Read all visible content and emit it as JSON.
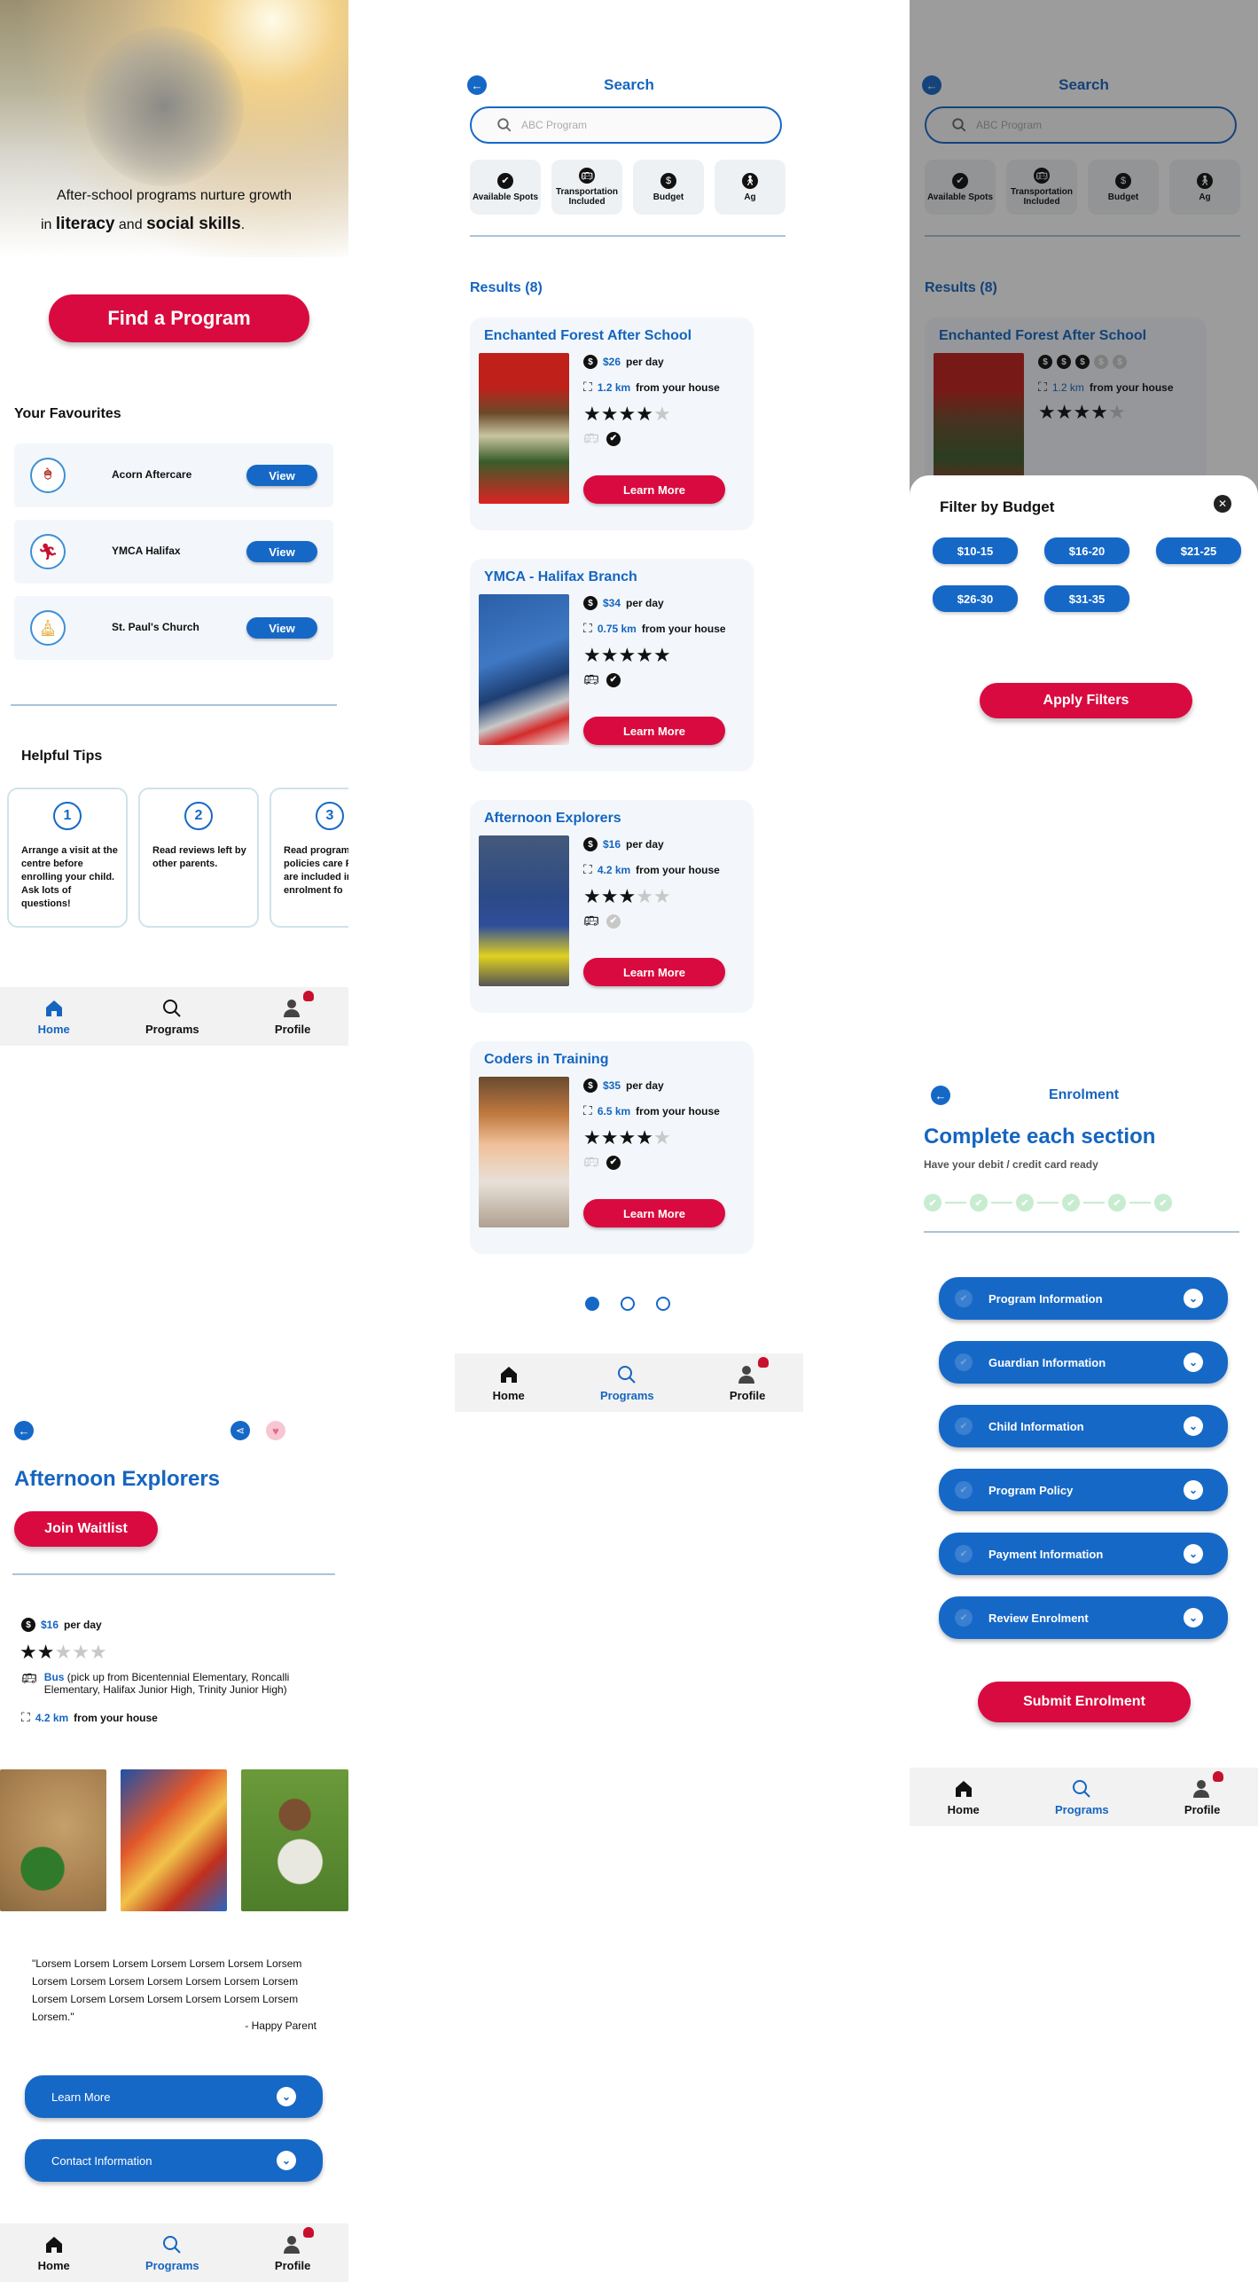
{
  "home": {
    "hero_line1": "After-school programs nurture growth",
    "hero_in": "in",
    "hero_literacy": "literacy",
    "hero_and": "and",
    "hero_social": "social skills",
    "hero_period": ".",
    "find_button": "Find a Program",
    "favourites_title": "Your Favourites",
    "favourites": [
      {
        "name": "Acorn Aftercare",
        "button": "View",
        "icon": "acorn-icon"
      },
      {
        "name": "YMCA Halifax",
        "button": "View",
        "icon": "runner-icon"
      },
      {
        "name": "St. Paul's Church",
        "button": "View",
        "icon": "church-icon"
      }
    ],
    "tips_title": "Helpful Tips",
    "tips": [
      {
        "num": "1",
        "text": "Arrange a visit at the centre before enrolling your child. Ask lots of questions!"
      },
      {
        "num": "2",
        "text": "Read reviews left by other parents."
      },
      {
        "num": "3",
        "text": "Read program policies care Policies are included in th enrolment fo"
      }
    ]
  },
  "nav": {
    "home": "Home",
    "programs": "Programs",
    "profile": "Profile"
  },
  "search": {
    "title": "Search",
    "placeholder": "ABC Program",
    "filters": [
      {
        "label": "Available Spots",
        "icon": "check-icon"
      },
      {
        "label": "Transportation Included",
        "icon": "bus-icon"
      },
      {
        "label": "Budget",
        "icon": "dollar-icon"
      },
      {
        "label": "Ag",
        "icon": "person-icon"
      }
    ],
    "results_label": "Results (8)",
    "per_day": "per day",
    "from_house": "from your house",
    "learn_more": "Learn More",
    "results": [
      {
        "name": "Enchanted Forest After School",
        "price": "$26",
        "distance": "1.2 km",
        "rating": 4,
        "transport": false,
        "spots": true
      },
      {
        "name": "YMCA - Halifax Branch",
        "price": "$34",
        "distance": "0.75 km",
        "rating": 5,
        "transport": true,
        "spots": true
      },
      {
        "name": "Afternoon Explorers",
        "price": "$16",
        "distance": "4.2 km",
        "rating": 3,
        "transport": true,
        "spots": false
      },
      {
        "name": "Coders in Training",
        "price": "$35",
        "distance": "6.5 km",
        "rating": 4,
        "transport": false,
        "spots": true
      }
    ],
    "pages": 3,
    "current_page": 1
  },
  "budget": {
    "overlay_title": "Search",
    "overlay_placeholder": "ABC Program",
    "overlay_result_name": "Enchanted Forest After School",
    "overlay_distance": "1.2 km",
    "overlay_from": "from your house",
    "overlay_results": "Results (8)",
    "sheet_title": "Filter by Budget",
    "options": [
      "$10-15",
      "$16-20",
      "$21-25",
      "$26-30",
      "$31-35"
    ],
    "apply": "Apply Filters"
  },
  "detail": {
    "title": "Afternoon Explorers",
    "waitlist": "Join Waitlist",
    "price": "$16",
    "per_day": "per day",
    "rating": 2,
    "bus_label": "Bus",
    "bus_detail": "(pick up from Bicentennial Elementary, Roncalli Elementary, Halifax Junior High, Trinity Junior High)",
    "distance": "4.2 km",
    "from_house": "from your house",
    "quote": "\"Lorsem Lorsem Lorsem Lorsem Lorsem Lorsem Lorsem Lorsem Lorsem Lorsem Lorsem Lorsem Lorsem Lorsem Lorsem Lorsem Lorsem Lorsem Lorsem Lorsem Lorsem Lorsem.\"",
    "quote_author": "- Happy Parent",
    "accordions": [
      "Learn More",
      "Contact Information"
    ]
  },
  "enrolment": {
    "title": "Enrolment",
    "heading": "Complete each section",
    "subheading": "Have your debit / credit card ready",
    "steps": 6,
    "sections": [
      "Program Information",
      "Guardian Information",
      "Child Information",
      "Program Policy",
      "Payment Information",
      "Review Enrolment"
    ],
    "submit": "Submit Enrolment"
  },
  "colors": {
    "accent": "#1565c0",
    "cta": "#d90a3f",
    "pill": "#1668c7",
    "step": "#c7ecd0"
  }
}
